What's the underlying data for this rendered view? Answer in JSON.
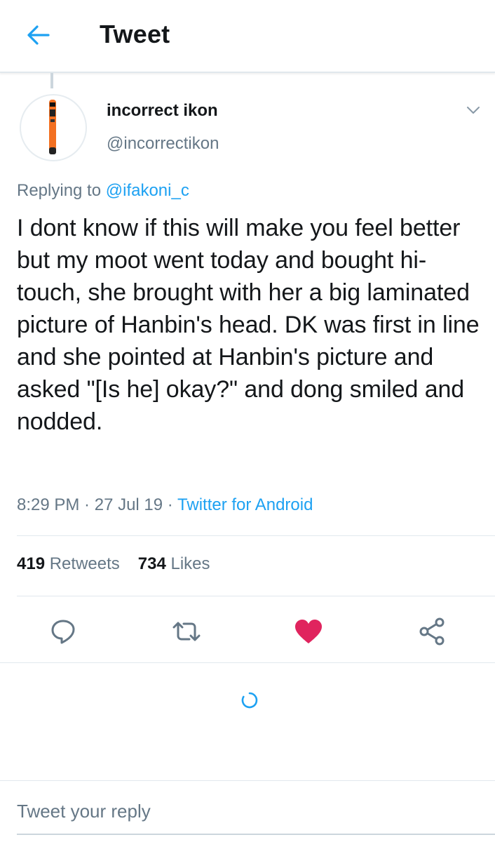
{
  "header": {
    "title": "Tweet",
    "back_icon": "arrow-left-icon",
    "accent": "#1da1f2"
  },
  "tweet": {
    "author_name": "incorrect ikon",
    "author_handle": "@incorrectikon",
    "avatar_icon": "bat-avatar",
    "replying_prefix": "Replying to",
    "replying_to": "@ifakoni_c",
    "text": "I dont know if this will make you feel better but my moot went today and bought hi-touch, she brought with her a big laminated picture of Hanbin's head. DK was first in line and she pointed at Hanbin's picture and asked \"[Is he] okay?\" and dong smiled and nodded.",
    "time": "8:29 PM",
    "date": "27 Jul 19",
    "separator": " · ",
    "source": "Twitter for Android"
  },
  "stats": {
    "retweets_count": "419",
    "retweets_label": "Retweets",
    "likes_count": "734",
    "likes_label": "Likes"
  },
  "actions": [
    {
      "name": "reply",
      "icon": "reply-icon"
    },
    {
      "name": "retweet",
      "icon": "retweet-icon"
    },
    {
      "name": "like",
      "icon": "heart-icon",
      "liked": true,
      "color": "#e0245e"
    },
    {
      "name": "share",
      "icon": "share-icon"
    }
  ],
  "reply_box": {
    "placeholder": "Tweet your reply"
  },
  "colors": {
    "text": "#14171a",
    "secondary": "#657786",
    "link": "#1da1f2",
    "like": "#e0245e",
    "divider": "#e1e8ed"
  }
}
